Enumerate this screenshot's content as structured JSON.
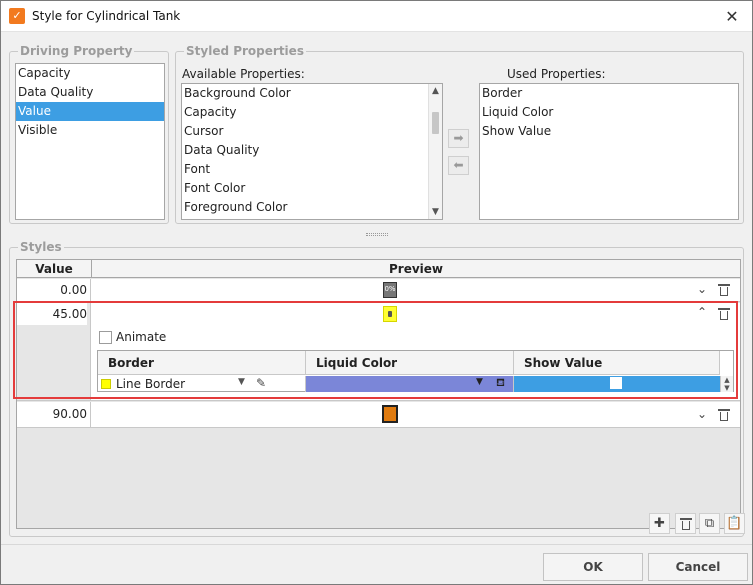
{
  "window": {
    "title": "Style for Cylindrical Tank",
    "close_glyph": "✕"
  },
  "driving_property": {
    "title": "Driving Property",
    "items": [
      "Capacity",
      "Data Quality",
      "Value",
      "Visible"
    ],
    "selected": "Value"
  },
  "styled_properties": {
    "title": "Styled Properties",
    "available_label": "Available Properties:",
    "available": [
      "Background Color",
      "Capacity",
      "Cursor",
      "Data Quality",
      "Font",
      "Font Color",
      "Foreground Color"
    ],
    "used_label": "Used Properties:",
    "used": [
      "Border",
      "Liquid Color",
      "Show Value"
    ]
  },
  "styles": {
    "title": "Styles",
    "col_value": "Value",
    "col_preview": "Preview",
    "rows": [
      {
        "value": "0.00",
        "expanded": false,
        "preview_label": "0%"
      },
      {
        "value": "45.00",
        "expanded": true
      },
      {
        "value": "90.00",
        "expanded": false
      }
    ],
    "expanded": {
      "animate_label": "Animate",
      "animate_checked": false,
      "columns": [
        "Border",
        "Liquid Color",
        "Show Value"
      ],
      "border_value": "Line Border",
      "border_swatch": "#ffff00",
      "liquid_color": "#7b86d8",
      "show_value_bg": "#3d9ee3",
      "show_value_checked": false
    }
  },
  "buttons": {
    "ok": "OK",
    "cancel": "Cancel"
  },
  "colors": {
    "accent": "#3d9ee3",
    "highlight": "#e43b3b",
    "brand": "#f27a1f"
  }
}
